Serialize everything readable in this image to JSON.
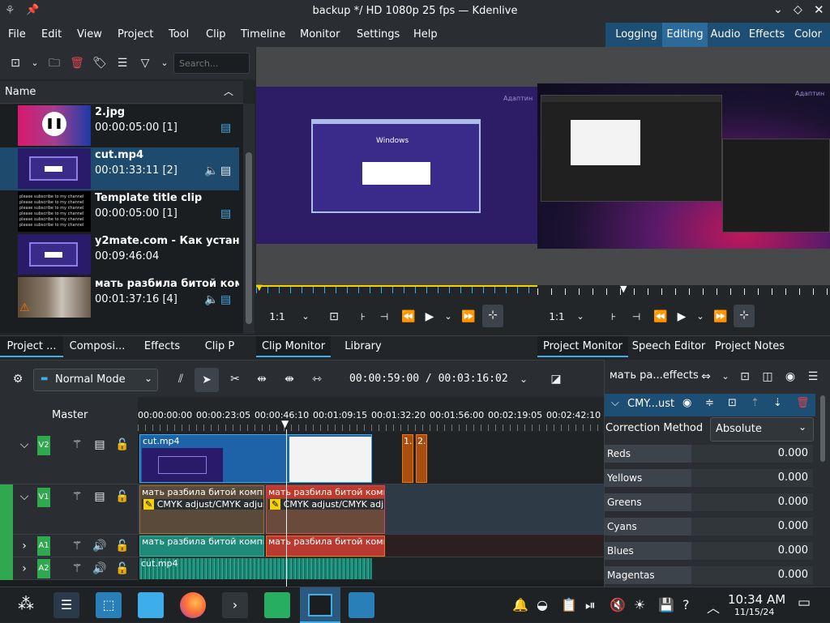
{
  "window": {
    "title": "backup */ HD 1080p 25 fps — Kdenlive"
  },
  "menubar": {
    "items": [
      "File",
      "Edit",
      "View",
      "Project",
      "Tool",
      "Clip",
      "Timeline",
      "Monitor",
      "Settings",
      "Help"
    ],
    "workspaces": [
      "Logging",
      "Editing",
      "Audio",
      "Effects",
      "Color"
    ],
    "active_workspace": "Editing"
  },
  "bin": {
    "search_placeholder": "Search...",
    "header": "Name",
    "clips": [
      {
        "name": "2.jpg",
        "duration": "00:00:05:00 [1]"
      },
      {
        "name": "cut.mp4",
        "duration": "00:01:33:11 [2]"
      },
      {
        "name": "Template title clip",
        "duration": "00:00:05:00 [1]"
      },
      {
        "name": "y2mate.com - Как установи",
        "duration": "00:09:46:04"
      },
      {
        "name": "мать разбила битой компь",
        "duration": "00:01:37:16 [4]"
      }
    ],
    "tabs": [
      "Project ...",
      "Composi...",
      "Effects",
      "Clip P"
    ]
  },
  "clip_monitor": {
    "watermark": "Адаптин",
    "window_label": "Windows",
    "zoom": "1:1",
    "tabs": [
      "Clip Monitor",
      "Library"
    ]
  },
  "project_monitor": {
    "watermark": "Адаптин",
    "zoom": "1:1",
    "tabs": [
      "Project Monitor",
      "Speech Editor",
      "Project Notes"
    ]
  },
  "timeline": {
    "mode": "Normal Mode",
    "timecode": "00:00:59:00 / 00:03:16:02",
    "master_label": "Master",
    "ruler": [
      "00:00:00:00",
      "00:00:23:05",
      "00:00:46:10",
      "00:01:09:15",
      "00:01:32:20",
      "00:01:56:00",
      "00:02:19:05",
      "00:02:42:10"
    ],
    "tracks": [
      {
        "name": "V2"
      },
      {
        "name": "V1"
      },
      {
        "name": "A1"
      },
      {
        "name": "A2"
      }
    ],
    "clips": {
      "v2_clip": "cut.mp4",
      "v2_small1": "1.",
      "v2_small2": "2.",
      "v1_clip1": "мать разбила битой компьк",
      "v1_clip1_effect": "CMYK adjust/CMYK adjust",
      "v1_clip2": "мать разбила битой компьк",
      "v1_clip2_effect": "CMYK adjust/CMYK adjus",
      "a1_clip1": "мать разбила битой компьк",
      "a1_clip2": "мать разбила битой компь",
      "a2_clip": "cut.mp4"
    }
  },
  "effects_panel": {
    "title": "мать ра...effects",
    "effect_name": "CMY...ust",
    "correction_label": "Correction Method",
    "correction_value": "Absolute",
    "params": [
      {
        "name": "Reds",
        "value": "0.000"
      },
      {
        "name": "Yellows",
        "value": "0.000"
      },
      {
        "name": "Greens",
        "value": "0.000"
      },
      {
        "name": "Cyans",
        "value": "0.000"
      },
      {
        "name": "Blues",
        "value": "0.000"
      },
      {
        "name": "Magentas",
        "value": "0.000"
      }
    ]
  },
  "taskbar": {
    "time": "10:34 AM",
    "date": "11/15/24"
  },
  "colors": {
    "accent": "#3daee9",
    "track_label": "#2fa84f",
    "clip_video": "#1e63a8",
    "clip_v1": "#a86e2e",
    "clip_v1_selected": "#c0392b",
    "clip_audio": "#1f8a7a"
  }
}
